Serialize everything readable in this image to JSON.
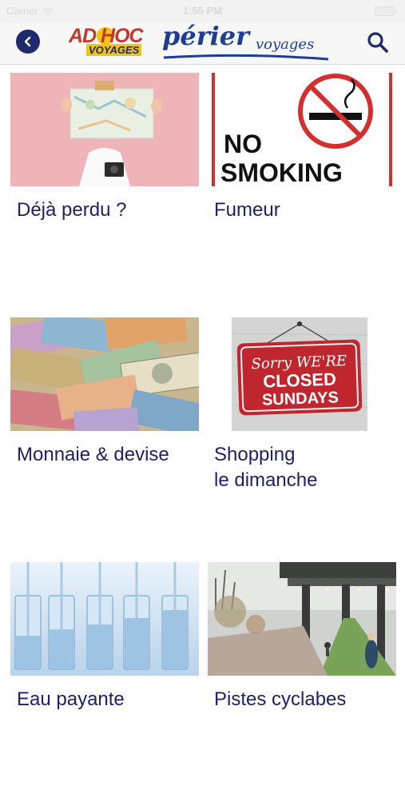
{
  "status_bar": {
    "carrier": "Carrier",
    "time": "1:55 PM"
  },
  "header": {
    "logo_adhoc_line1": "AD HOC",
    "logo_adhoc_line2": "VOYAGES",
    "logo_perier_main": "périer",
    "logo_perier_sub": "voyages",
    "back_icon": "chevron-left-icon",
    "search_icon": "search-icon",
    "accent_color": "#1e2a6e"
  },
  "tiles": [
    {
      "label": "Déjà perdu ?",
      "image": "woman-holding-map"
    },
    {
      "label": "Fumeur",
      "image": "no-smoking-sign",
      "sign_text_1": "NO",
      "sign_text_2": "SMOKING"
    },
    {
      "label": "Monnaie & devise",
      "image": "banknotes"
    },
    {
      "label": "Shopping\nle dimanche",
      "image": "closed-sundays-sign",
      "sign_text_1": "Sorry WE'RE",
      "sign_text_2": "CLOSED",
      "sign_text_3": "SUNDAYS"
    },
    {
      "label": "Eau payante",
      "image": "water-glasses"
    },
    {
      "label": "Pistes cyclabes",
      "image": "bike-path"
    }
  ]
}
